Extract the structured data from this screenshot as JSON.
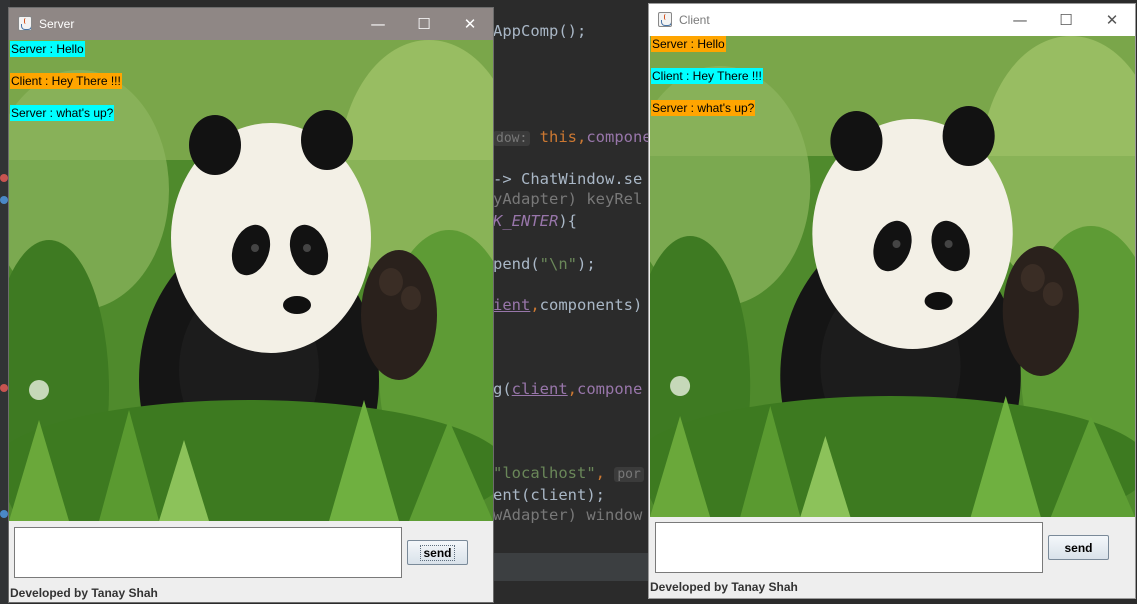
{
  "ide": {
    "code_lines": [
      {
        "parts": [
          {
            "t": "AppComp();",
            "c": ""
          }
        ]
      },
      {
        "parts": [
          {
            "t": "dow:",
            "c": "hint"
          },
          {
            "t": " ",
            "c": ""
          },
          {
            "t": "this",
            "c": "kw"
          },
          {
            "t": ",",
            "c": "kw"
          },
          {
            "t": "compone",
            "c": "field"
          }
        ]
      },
      {
        "parts": [
          {
            "t": "-> ChatWindow.se",
            "c": ""
          }
        ]
      },
      {
        "parts": [
          {
            "t": "yAdapter) keyRel",
            "c": "gray"
          }
        ]
      },
      {
        "parts": [
          {
            "t": "K_ENTER",
            "c": "italic"
          },
          {
            "t": "){",
            "c": ""
          }
        ]
      },
      {
        "parts": [
          {
            "t": "pend(",
            "c": ""
          },
          {
            "t": "\"\\n\"",
            "c": "str"
          },
          {
            "t": ");",
            "c": ""
          }
        ]
      },
      {
        "parts": [
          {
            "t": "ient",
            "c": "underline"
          },
          {
            "t": ",",
            "c": "kw"
          },
          {
            "t": "components)",
            "c": ""
          }
        ]
      },
      {
        "parts": [
          {
            "t": "g(",
            "c": ""
          },
          {
            "t": "client",
            "c": "underline"
          },
          {
            "t": ",",
            "c": "kw"
          },
          {
            "t": "compone",
            "c": "field"
          }
        ]
      },
      {
        "parts": [
          {
            "t": "\"localhost\"",
            "c": "str"
          },
          {
            "t": ",",
            "c": "kw"
          },
          {
            "t": " ",
            "c": ""
          },
          {
            "t": "por",
            "c": "hint"
          }
        ]
      },
      {
        "parts": [
          {
            "t": "ent(client);",
            "c": ""
          }
        ]
      },
      {
        "parts": [
          {
            "t": "wAdapter) window",
            "c": "gray"
          }
        ]
      }
    ]
  },
  "server": {
    "title": "Server",
    "controls": {
      "minimize": "—",
      "maximize": "☐",
      "close": "✕"
    },
    "messages": [
      {
        "sender": "server",
        "text": "Server : Hello"
      },
      {
        "sender": "client",
        "text": "Client : Hey There !!!"
      },
      {
        "sender": "server",
        "text": "Server : what's up?"
      }
    ],
    "input_value": "",
    "send_label": "send",
    "footer": "Developed by Tanay Shah"
  },
  "client": {
    "title": "Client",
    "controls": {
      "minimize": "—",
      "maximize": "☐",
      "close": "✕"
    },
    "messages": [
      {
        "sender": "client",
        "text": "Server : Hello"
      },
      {
        "sender": "server",
        "text": "Client : Hey There !!!"
      },
      {
        "sender": "client",
        "text": "Server : what's up?"
      }
    ],
    "input_value": "",
    "send_label": "send",
    "footer": "Developed by Tanay Shah"
  },
  "colors": {
    "server_message_bg": "#00ffff",
    "client_message_bg": "#ffa500",
    "ide_background": "#2b2b2b"
  }
}
